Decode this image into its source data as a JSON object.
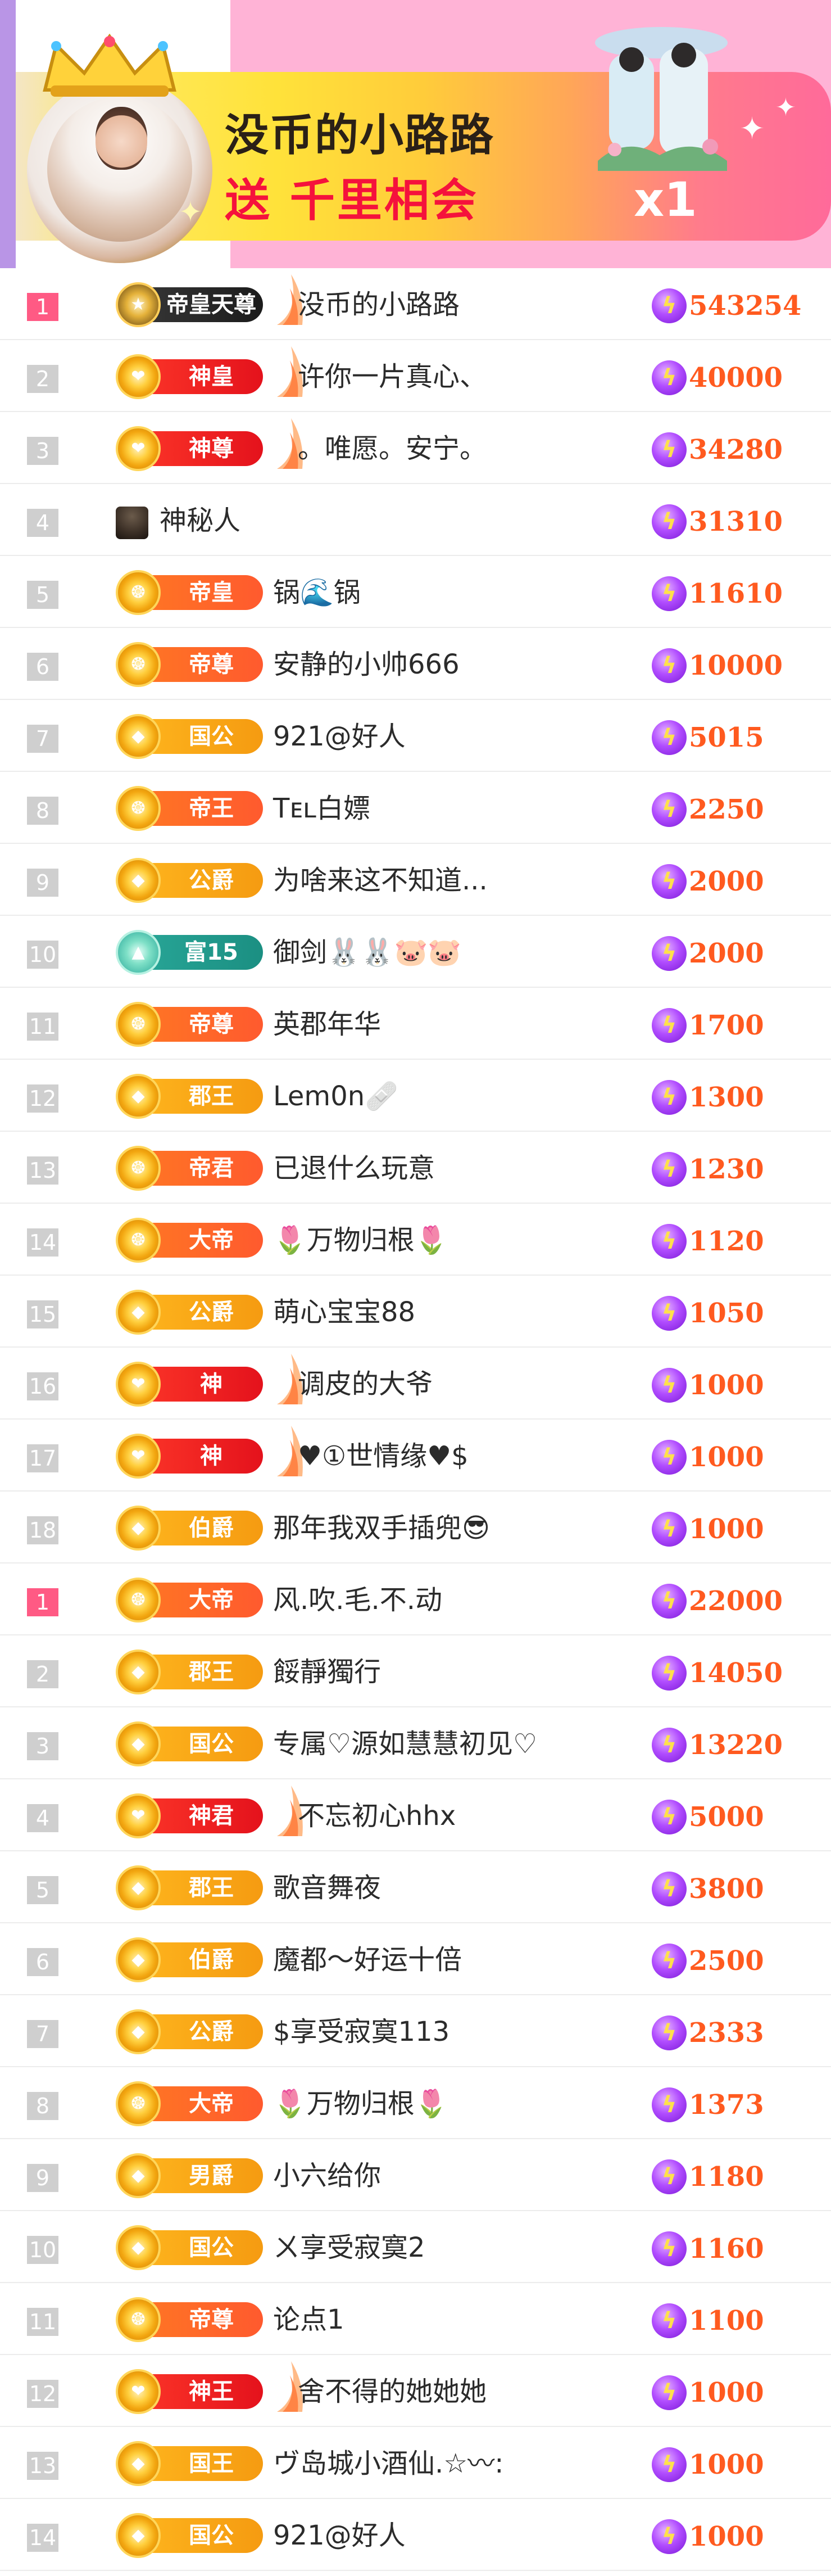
{
  "banner": {
    "title": "没币的小路路",
    "gift_line": "送 千里相会",
    "count": "x1",
    "colors": {
      "left_strip": "#b995e6",
      "pink": "#ffb3d6",
      "title": "#2a2017",
      "gift": "#f5123c"
    }
  },
  "colors": {
    "rank_first": "#ff5a84",
    "rank": "#cfcfcf",
    "value": "#ff5a1f",
    "coin": "#8a2be2"
  },
  "rows": [
    {
      "rank": "1",
      "first": true,
      "badge": "帝皇天尊",
      "badge_style": "black",
      "name": "没币的小路路",
      "value": "543254",
      "wing": true
    },
    {
      "rank": "2",
      "badge": "神皇",
      "badge_style": "red",
      "name": "许你一片真心、",
      "value": "40000",
      "wing": true
    },
    {
      "rank": "3",
      "badge": "神尊",
      "badge_style": "red",
      "name": "。唯愿。安宁。",
      "value": "34280",
      "wing": true
    },
    {
      "rank": "4",
      "badge": "",
      "badge_style": "mystery",
      "name": "神秘人",
      "value": "31310",
      "icon": "mystery-person-icon"
    },
    {
      "rank": "5",
      "badge": "帝皇",
      "badge_style": "orange",
      "name": "锅🌊锅",
      "value": "11610"
    },
    {
      "rank": "6",
      "badge": "帝尊",
      "badge_style": "orange",
      "name": "安静的小帅666",
      "value": "10000"
    },
    {
      "rank": "7",
      "badge": "国公",
      "badge_style": "gold",
      "name": "921@好人",
      "value": "5015"
    },
    {
      "rank": "8",
      "badge": "帝王",
      "badge_style": "orange",
      "name": "Tᴇʟ白嫖",
      "value": "2250"
    },
    {
      "rank": "9",
      "badge": "公爵",
      "badge_style": "gold",
      "name": "为啥来这不知道...",
      "value": "2000"
    },
    {
      "rank": "10",
      "badge": "富15",
      "badge_style": "teal",
      "name": "御剑🐰🐰🐷🐷",
      "value": "2000"
    },
    {
      "rank": "11",
      "badge": "帝尊",
      "badge_style": "orange",
      "name": "英郡年华",
      "value": "1700"
    },
    {
      "rank": "12",
      "badge": "郡王",
      "badge_style": "gold",
      "name": "Lem0n🩹",
      "value": "1300"
    },
    {
      "rank": "13",
      "badge": "帝君",
      "badge_style": "orange",
      "name": "已退什么玩意",
      "value": "1230"
    },
    {
      "rank": "14",
      "badge": "大帝",
      "badge_style": "orange",
      "name": "🌷万物归根🌷",
      "value": "1120"
    },
    {
      "rank": "15",
      "badge": "公爵",
      "badge_style": "gold",
      "name": "萌心宝宝88",
      "value": "1050"
    },
    {
      "rank": "16",
      "badge": "神",
      "badge_style": "red",
      "name": "调皮的大爷",
      "value": "1000",
      "wing": true
    },
    {
      "rank": "17",
      "badge": "神",
      "badge_style": "red",
      "name": "♥①世情缘♥$",
      "value": "1000",
      "wing": true
    },
    {
      "rank": "18",
      "badge": "伯爵",
      "badge_style": "gold",
      "name": "那年我双手插兜😎",
      "value": "1000"
    },
    {
      "rank": "1",
      "first": true,
      "badge": "大帝",
      "badge_style": "orange",
      "name": "风.吹.毛.不.动",
      "value": "22000"
    },
    {
      "rank": "2",
      "badge": "郡王",
      "badge_style": "gold",
      "name": "餒靜獨行",
      "value": "14050"
    },
    {
      "rank": "3",
      "badge": "国公",
      "badge_style": "gold",
      "name": "专属♡源如慧慧初见♡",
      "value": "13220"
    },
    {
      "rank": "4",
      "badge": "神君",
      "badge_style": "red",
      "name": "不忘初心hhx",
      "value": "5000",
      "wing": true
    },
    {
      "rank": "5",
      "badge": "郡王",
      "badge_style": "gold",
      "name": "歌音舞夜",
      "value": "3800"
    },
    {
      "rank": "6",
      "badge": "伯爵",
      "badge_style": "gold",
      "name": "魔都～好运十倍",
      "value": "2500"
    },
    {
      "rank": "7",
      "badge": "公爵",
      "badge_style": "gold",
      "name": "$享受寂寞113",
      "value": "2333"
    },
    {
      "rank": "8",
      "badge": "大帝",
      "badge_style": "orange",
      "name": "🌷万物归根🌷",
      "value": "1373"
    },
    {
      "rank": "9",
      "badge": "男爵",
      "badge_style": "gold",
      "name": "小六给你",
      "value": "1180"
    },
    {
      "rank": "10",
      "badge": "国公",
      "badge_style": "gold",
      "name": "ㄨ享受寂寞2",
      "value": "1160"
    },
    {
      "rank": "11",
      "badge": "帝尊",
      "badge_style": "orange",
      "name": "论点1",
      "value": "1100"
    },
    {
      "rank": "12",
      "badge": "神王",
      "badge_style": "red",
      "name": "舍不得的她她她",
      "value": "1000",
      "wing": true
    },
    {
      "rank": "13",
      "badge": "国王",
      "badge_style": "gold",
      "name": "ヴ岛城小酒仙.☆〰:",
      "value": "1000"
    },
    {
      "rank": "14",
      "badge": "国公",
      "badge_style": "gold",
      "name": "921@好人",
      "value": "1000"
    }
  ]
}
